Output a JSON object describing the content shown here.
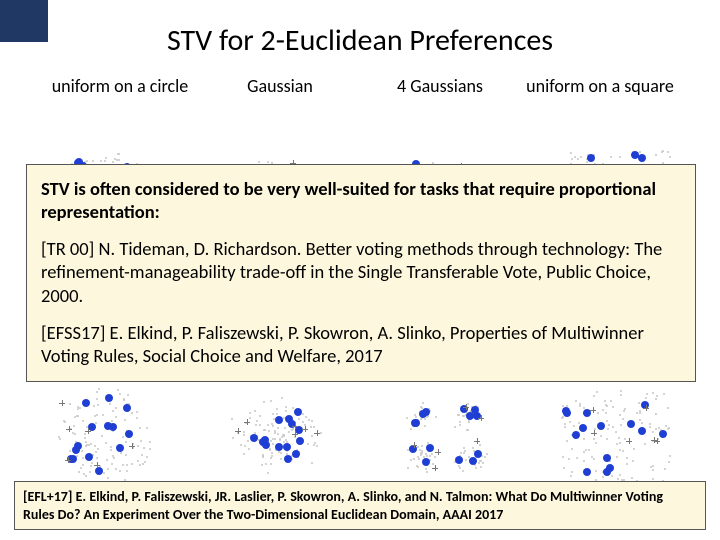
{
  "title": "STV for 2-Euclidean Preferences",
  "columns": [
    "uniform on\na circle",
    "Gaussian",
    "4 Gaussians",
    "uniform on\na square"
  ],
  "overlay": {
    "intro_bold": "STV is often considered to be very well-suited for tasks that require proportional representation:",
    "ref1": "[TR 00] N. Tideman, D. Richardson. Better voting methods through technology: The  refinement-manageability trade-off in the Single Transferable Vote, Public Choice, 2000.",
    "ref2": "[EFSS17] E. Elkind, P. Faliszewski, P. Skowron, A. Slinko, Properties of Multiwinner Voting Rules, Social Choice and Welfare, 2017"
  },
  "citation": "[EFL+17] E. Elkind, P. Faliszewski, JR. Laslier, P. Skowron, A. Slinko, and N. Talmon: What Do Multiwinner Voting Rules Do? An Experiment Over the Two-Dimensional Euclidean Domain, AAAI 2017"
}
